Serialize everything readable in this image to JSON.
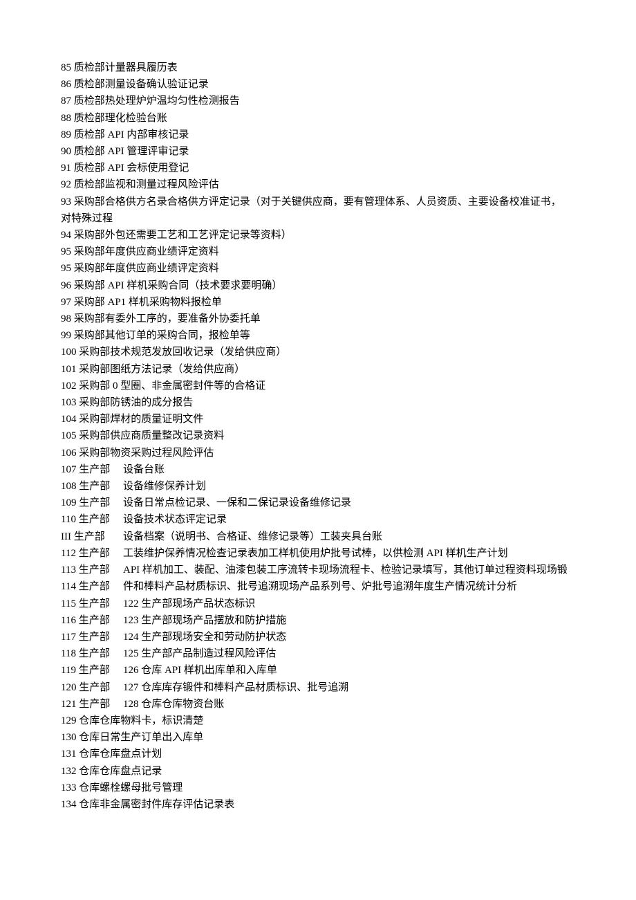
{
  "lines": [
    "85 质检部计量器具履历表",
    "86 质检部测量设备确认验证记录",
    "87 质检部热处理炉炉温均匀性检测报告",
    "88 质检部理化检验台账",
    "89 质检部 API 内部审核记录",
    "90 质检部 API 管理评审记录",
    "91 质检部 API 会标使用登记",
    "92 质检部监视和测量过程风险评估",
    "93 采购部合格供方名录合格供方评定记录（对于关键供应商，要有管理体系、人员资质、主要设备校准证书，",
    "对特殊过程",
    "94 采购部外包还需要工艺和工艺评定记录等资料）",
    "95 采购部年度供应商业绩评定资料",
    "95 采购部年度供应商业绩评定资料",
    "96 采购部 API 样机采购合同（技术要求要明确）",
    "97 采购部 AP1 样机采购物料报检单",
    "98 采购部有委外工序的，要准备外协委托单",
    "99 采购部其他订单的采购合同，报检单等",
    "100 采购部技术规范发放回收记录（发给供应商）",
    "101 采购部图纸方法记录（发给供应商）",
    "102 采购部 0 型圈、非金属密封件等的合格证",
    "103 采购部防锈油的成分报告",
    "104 采购部焊材的质量证明文件",
    "105 采购部供应商质量整改记录资料",
    "106 采购部物资采购过程风险评估"
  ],
  "col2": [
    {
      "left": "107 生产部",
      "right": "设备台账"
    },
    {
      "left": "108 生产部",
      "right": "设备维修保养计划"
    },
    {
      "left": "109 生产部",
      "right": "设备日常点检记录、一保和二保记录设备维修记录"
    },
    {
      "left": "110 生产部",
      "right": "设备技术状态评定记录"
    },
    {
      "left": "III 生产部",
      "right": "设备档案（说明书、合格证、维修记录等）工装夹具台账"
    },
    {
      "left": "112 生产部",
      "right": "工装维护保养情况检查记录表加工样机使用炉批号试棒，以供检测 API 样机生产计划"
    },
    {
      "left": "113 生产部",
      "right": "API 样机加工、装配、油漆包装工序流转卡现场流程卡、检验记录填写，其他订单过程资料现场锻"
    },
    {
      "left": "114 生产部",
      "right": "件和棒料产品材质标识、批号追溯现场产品系列号、炉批号追溯年度生产情况统计分析"
    },
    {
      "left": "115 生产部",
      "right": "122 生产部现场产品状态标识"
    },
    {
      "left": "116 生产部",
      "right": "123 生产部现场产品摆放和防护措施"
    },
    {
      "left": "117 生产部",
      "right": "124 生产部现场安全和劳动防护状态"
    },
    {
      "left": "118 生产部",
      "right": "125 生产部产品制造过程风险评估"
    },
    {
      "left": "119 生产部",
      "right": "126 仓库 API 样机出库单和入库单"
    },
    {
      "left": "120 生产部",
      "right": "127 仓库库存锻件和棒料产品材质标识、批号追溯"
    },
    {
      "left": "121 生产部",
      "right": "128 仓库仓库物资台账"
    }
  ],
  "tail": [
    "129 仓库仓库物料卡，标识清楚",
    "130 仓库日常生产订单出入库单",
    "131 仓库仓库盘点计划",
    "132 仓库仓库盘点记录",
    "133 仓库螺栓螺母批号管理",
    "134 仓库非金属密封件库存评估记录表"
  ]
}
